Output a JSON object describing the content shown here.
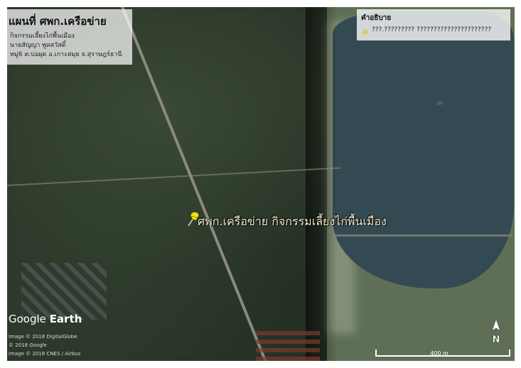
{
  "title_panel": {
    "title": "แผนที่ ศพก.เครือข่าย",
    "line1": "กิจกรรมเลี้ยงไก่พื้นเมือง",
    "line2": "นายสัญญา พูลสวัสดิ์",
    "line3": "หมู่6 ต.บ่อผุด อ.เกาะสมุย จ.สุราษฎร์ธานี"
  },
  "legend": {
    "title": "คำอธิบาย",
    "item_text": "???.????????? ??????????????????????",
    "item_icon": "yellow-pushpin-icon",
    "item_color": "#f2e21a"
  },
  "placemark": {
    "label": "ศพก.เครือข่าย กิจกรรมเลี้ยงไก่พื้นเมือง",
    "icon": "yellow-pushpin-icon",
    "color": "#f2e21a"
  },
  "lake_label": "???",
  "branding": {
    "logo_word1": "Google",
    "logo_word2": "Earth",
    "credit1": "Image © 2018 DigitalGlobe",
    "credit2": "© 2018 Google",
    "credit3": "Image © 2018 CNES / Airbus"
  },
  "scale": {
    "label": "400 m"
  },
  "north_arrow": {
    "label": "N"
  }
}
